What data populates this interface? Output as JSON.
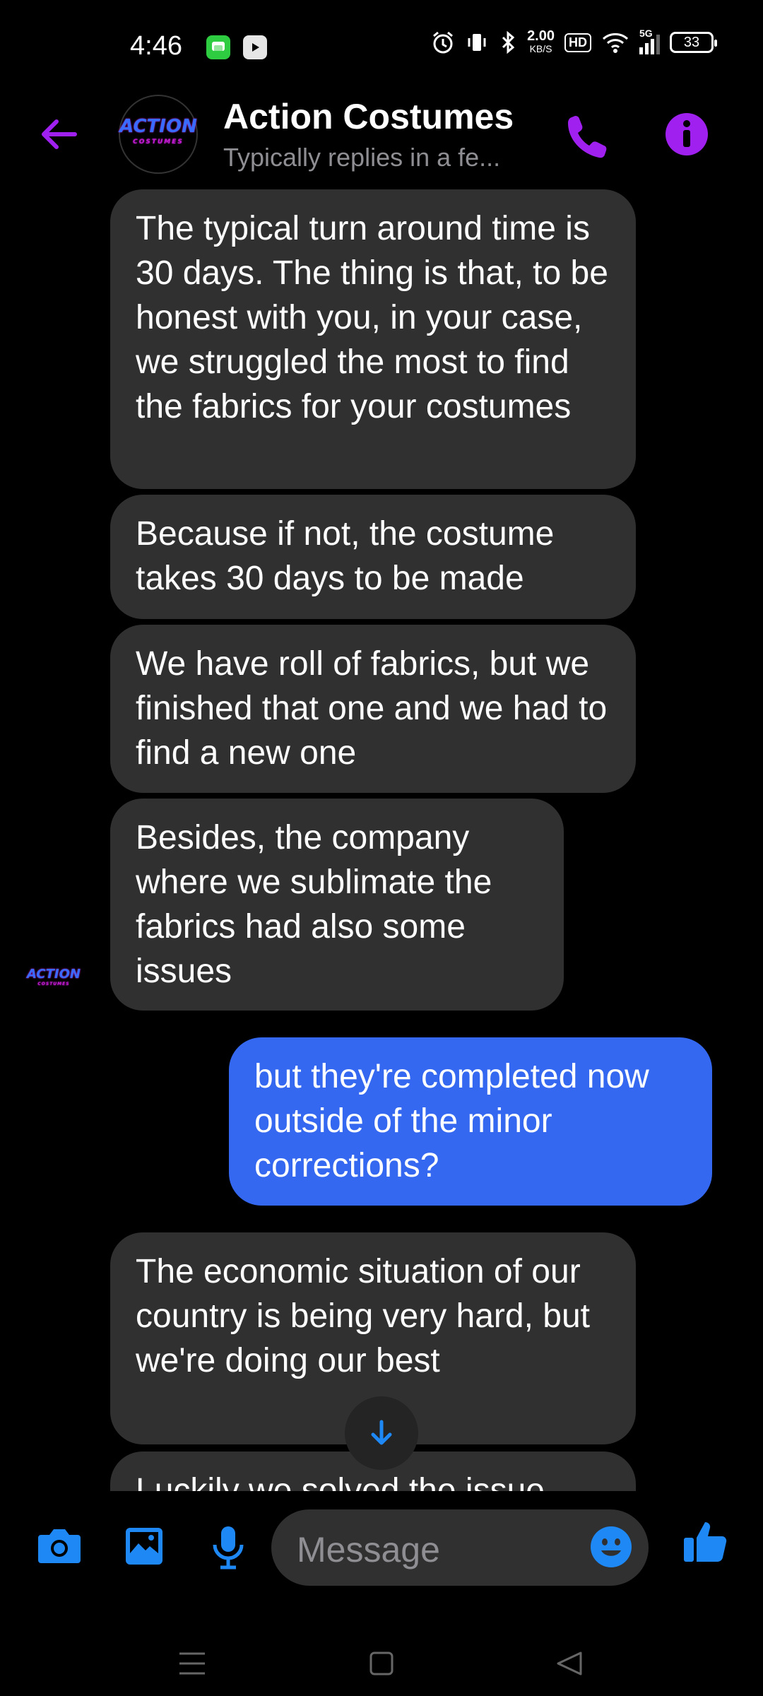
{
  "status_bar": {
    "time": "4:46",
    "net_speed_value": "2.00",
    "net_speed_unit": "KB/S",
    "hd_label": "HD",
    "network_type": "5G",
    "battery": "33"
  },
  "header": {
    "contact_name": "Action Costumes",
    "status_line": "Typically replies in a fe...",
    "logo_text": "ACTION",
    "logo_subtext": "COSTUMES"
  },
  "messages": [
    {
      "direction": "received",
      "text": "The typical turn around time is 30 days. The thing is that, to be honest with you, in your case, we struggled the most to find the fabrics for your costumes"
    },
    {
      "direction": "received",
      "text": "Because if not, the costume takes 30 days to be made"
    },
    {
      "direction": "received",
      "text": "We have roll of fabrics, but we finished that one and we had to find a new one"
    },
    {
      "direction": "received",
      "text": "Besides, the company where we sublimate the fabrics had also some issues"
    },
    {
      "direction": "sent",
      "text": "but they're completed now outside of the minor corrections?"
    },
    {
      "direction": "received",
      "text": "The economic situation of our country is being very hard, but we're doing our best"
    },
    {
      "direction": "received",
      "text": "Luckily we solved the issue"
    }
  ],
  "composer": {
    "placeholder": "Message"
  },
  "colors": {
    "accent_purple": "#a020f0",
    "accent_blue": "#1e88f5",
    "sent_bubble": "#3568f0",
    "received_bubble": "#303030"
  },
  "icons": {
    "back": "arrow-left-icon",
    "call": "phone-icon",
    "info": "info-icon",
    "camera": "camera-icon",
    "gallery": "image-icon",
    "mic": "microphone-icon",
    "emoji": "smiley-icon",
    "like": "thumbs-up-icon",
    "scroll": "arrow-down-icon"
  }
}
